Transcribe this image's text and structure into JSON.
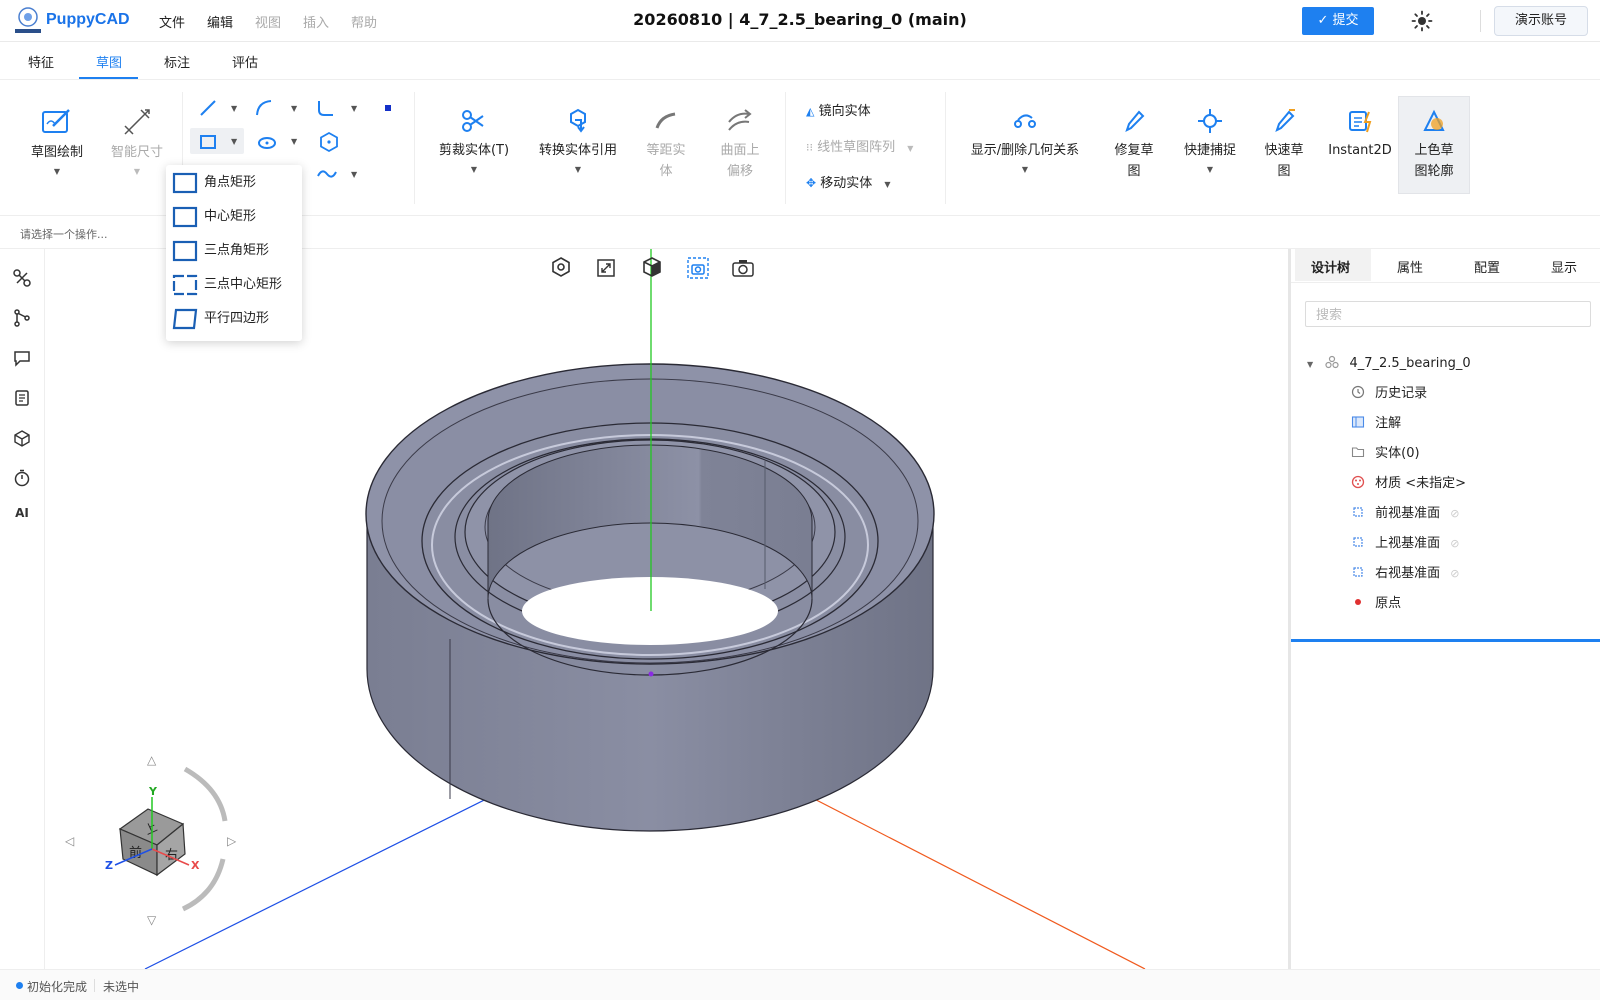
{
  "app": {
    "brand": "PuppyCAD",
    "logo_icon": "puppycad-logo-icon",
    "document_title": "20260810 | 4_7_2.5_bearing_0  (main)"
  },
  "menu": [
    {
      "label": "文件",
      "enabled": true
    },
    {
      "label": "编辑",
      "enabled": true
    },
    {
      "label": "视图",
      "enabled": false
    },
    {
      "label": "插入",
      "enabled": false
    },
    {
      "label": "帮助",
      "enabled": false
    }
  ],
  "header": {
    "submit_label": "提交",
    "theme_icon": "sun-icon",
    "account_label": "演示账号"
  },
  "tabs": [
    {
      "label": "特征",
      "active": false
    },
    {
      "label": "草图",
      "active": true
    },
    {
      "label": "标注",
      "active": false
    },
    {
      "label": "评估",
      "active": false
    }
  ],
  "ribbon": {
    "sketch_draw": "草图绘制",
    "smart_dim": "智能尺寸",
    "trim": "剪裁实体(T)",
    "convert": "转换实体引用",
    "offset_1": "等距实",
    "offset_2": "体",
    "surface_offset_1": "曲面上",
    "surface_offset_2": "偏移",
    "mirror": "镜向实体",
    "linear_pattern": "线性草图阵列",
    "move": "移动实体",
    "relations": "显示/删除几何关系",
    "repair_1": "修复草",
    "repair_2": "图",
    "snap": "快捷捕捉",
    "quick_1": "快速草",
    "quick_2": "图",
    "instant2d": "Instant2D",
    "shade_1": "上色草",
    "shade_2": "图轮廓"
  },
  "rect_dropdown": [
    {
      "label": "角点矩形",
      "icon": "corner-rectangle-icon"
    },
    {
      "label": "中心矩形",
      "icon": "center-rectangle-icon"
    },
    {
      "label": "三点角矩形",
      "icon": "three-point-corner-rectangle-icon"
    },
    {
      "label": "三点中心矩形",
      "icon": "three-point-center-rectangle-icon"
    },
    {
      "label": "平行四边形",
      "icon": "parallelogram-icon"
    }
  ],
  "hint": "请选择一个操作...",
  "left_toolbar": [
    "assembly-icon",
    "branch-icon",
    "comment-icon",
    "document-icon",
    "cube-icon",
    "timer-icon",
    "AI"
  ],
  "viewport": {
    "tools": [
      "view-orient-icon",
      "zoom-fit-icon",
      "view-cube-icon",
      "section-view-icon",
      "screenshot-icon"
    ],
    "cube_faces": {
      "top": "上",
      "front": "前",
      "right": "右"
    },
    "axes": {
      "x": "X",
      "y": "Y",
      "z": "Z"
    }
  },
  "right_panel": {
    "tabs": [
      {
        "label": "设计树",
        "active": true
      },
      {
        "label": "属性",
        "active": false
      },
      {
        "label": "配置",
        "active": false
      },
      {
        "label": "显示",
        "active": false
      }
    ],
    "search_placeholder": "搜索",
    "tree": {
      "root": "4_7_2.5_bearing_0",
      "items": [
        {
          "label": "历史记录",
          "icon": "history-icon"
        },
        {
          "label": "注解",
          "icon": "annotation-icon"
        },
        {
          "label": "实体(0)",
          "icon": "folder-icon"
        },
        {
          "label": "材质 <未指定>",
          "icon": "material-icon"
        },
        {
          "label": "前视基准面",
          "icon": "plane-icon"
        },
        {
          "label": "上视基准面",
          "icon": "plane-icon"
        },
        {
          "label": "右视基准面",
          "icon": "plane-icon"
        },
        {
          "label": "原点",
          "icon": "origin-icon"
        }
      ]
    }
  },
  "status": {
    "init": "初始化完成",
    "selection": "未选中"
  },
  "colors": {
    "accent": "#1e80f0",
    "axis_x": "#f05a1e",
    "axis_y": "#22c822",
    "axis_z": "#1e50e6",
    "bearing": "#868aa0"
  }
}
